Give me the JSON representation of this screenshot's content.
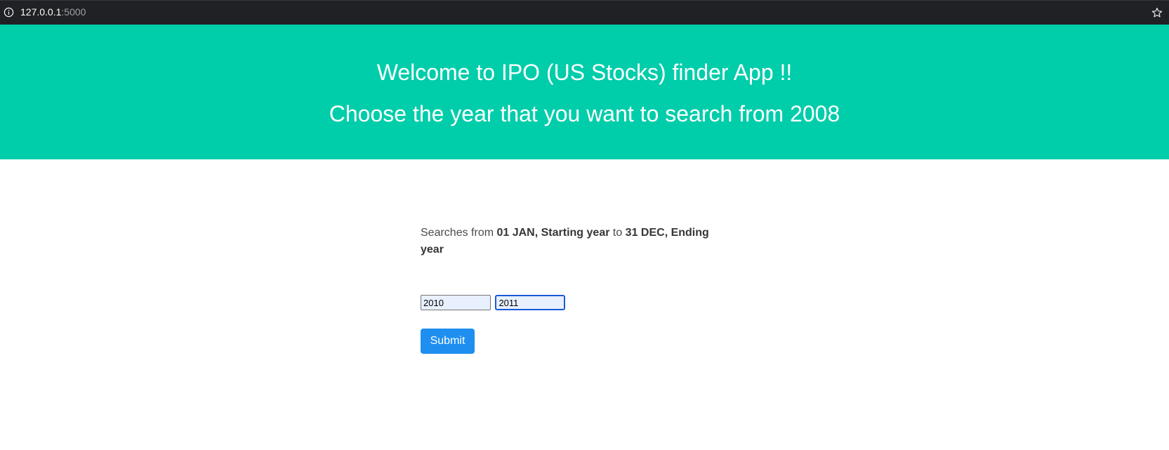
{
  "browser": {
    "url_host": "127.0.0.1",
    "url_port": ":5000",
    "info_icon": "info-icon",
    "bookmark_icon": "star-icon"
  },
  "hero": {
    "title": "Welcome to IPO (US Stocks) finder App !!",
    "subtitle": "Choose the year that you want to search from 2008",
    "background_color": "#00cdaa"
  },
  "form": {
    "description_prefix": "Searches from ",
    "description_start": "01 JAN, Starting year",
    "description_middle": " to ",
    "description_end": "31 DEC, Ending year",
    "start_year_value": "2010",
    "end_year_value": "2011",
    "submit_label": "Submit",
    "submit_color": "#1e8ff0"
  }
}
